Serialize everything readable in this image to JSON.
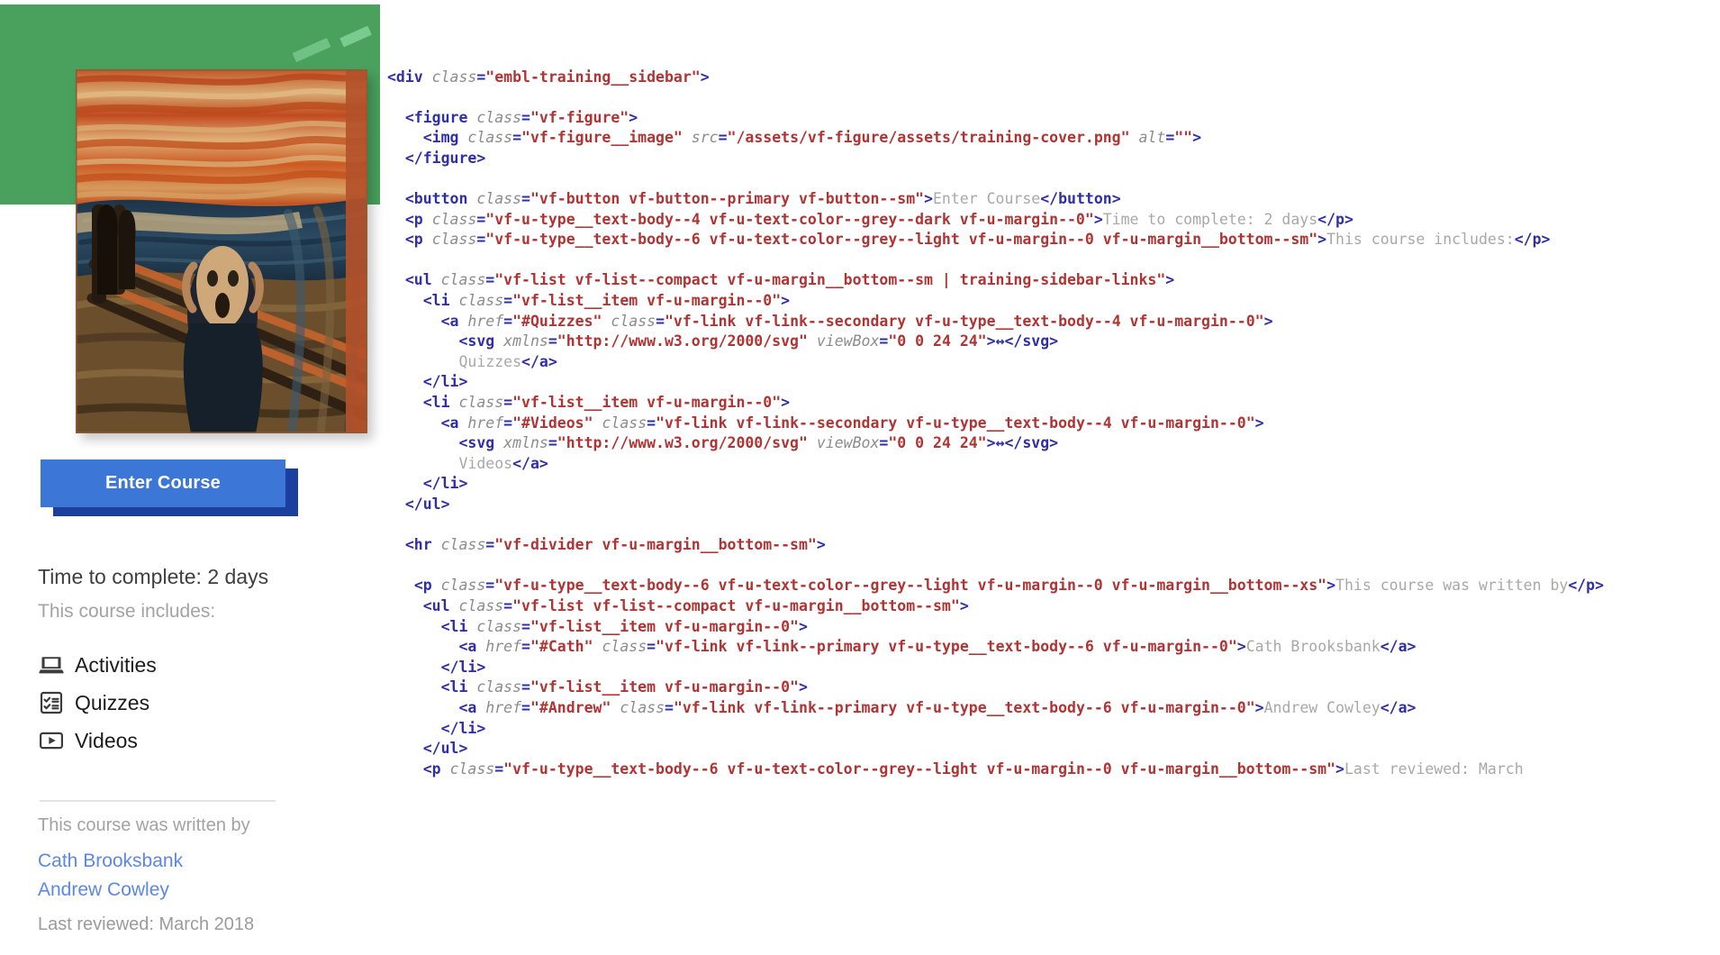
{
  "sidebar": {
    "cover": {
      "alt_label": "course-cover-image",
      "green_accent_color": "#4aa15e",
      "green_dash_color": "#6fc184"
    },
    "enter_course_label": "Enter Course",
    "enter_course_color": "#3c76d6",
    "enter_course_shadow_color": "#1b3f9f",
    "time_to_complete": "Time to complete: 2 days",
    "course_includes_label": "This course includes:",
    "includes": [
      {
        "icon": "laptop-icon",
        "label": "Activities"
      },
      {
        "icon": "checklist-icon",
        "label": "Quizzes"
      },
      {
        "icon": "video-play-icon",
        "label": "Videos"
      }
    ],
    "written_by_label": "This course was written by",
    "authors": [
      {
        "name": "Cath Brooksbank"
      },
      {
        "name": "Andrew Cowley"
      }
    ],
    "author_link_color": "#5b87e8",
    "last_reviewed": "Last reviewed: March 2018"
  },
  "code": {
    "language": "html",
    "colors": {
      "tag": "#2f2fa8",
      "attribute": "#8c8c8c",
      "value": "#b03434",
      "text": "#a8a8a8",
      "background": "#ffffff"
    },
    "lines": [
      [
        {
          "t": "tag",
          "s": "<div "
        },
        {
          "t": "attr",
          "s": "class"
        },
        {
          "t": "tag",
          "s": "="
        },
        {
          "t": "val",
          "s": "\"embl-training__sidebar\""
        },
        {
          "t": "tag",
          "s": ">"
        }
      ],
      [],
      [
        {
          "t": "tag",
          "s": "  <figure "
        },
        {
          "t": "attr",
          "s": "class"
        },
        {
          "t": "tag",
          "s": "="
        },
        {
          "t": "val",
          "s": "\"vf-figure\""
        },
        {
          "t": "tag",
          "s": ">"
        }
      ],
      [
        {
          "t": "tag",
          "s": "    <img "
        },
        {
          "t": "attr",
          "s": "class"
        },
        {
          "t": "tag",
          "s": "="
        },
        {
          "t": "val",
          "s": "\"vf-figure__image\""
        },
        {
          "t": "tag",
          "s": " "
        },
        {
          "t": "attr",
          "s": "src"
        },
        {
          "t": "tag",
          "s": "="
        },
        {
          "t": "val",
          "s": "\"/assets/vf-figure/assets/training-cover.png\""
        },
        {
          "t": "tag",
          "s": " "
        },
        {
          "t": "attr",
          "s": "alt"
        },
        {
          "t": "tag",
          "s": "="
        },
        {
          "t": "val",
          "s": "\"\""
        },
        {
          "t": "tag",
          "s": ">"
        }
      ],
      [
        {
          "t": "tag",
          "s": "  </figure>"
        }
      ],
      [],
      [
        {
          "t": "tag",
          "s": "  <button "
        },
        {
          "t": "attr",
          "s": "class"
        },
        {
          "t": "tag",
          "s": "="
        },
        {
          "t": "val",
          "s": "\"vf-button vf-button--primary vf-button--sm\""
        },
        {
          "t": "tag",
          "s": ">"
        },
        {
          "t": "txt",
          "s": "Enter Course"
        },
        {
          "t": "tag",
          "s": "</button>"
        }
      ],
      [
        {
          "t": "tag",
          "s": "  <p "
        },
        {
          "t": "attr",
          "s": "class"
        },
        {
          "t": "tag",
          "s": "="
        },
        {
          "t": "val",
          "s": "\"vf-u-type__text-body--4 vf-u-text-color--grey--dark vf-u-margin--0\""
        },
        {
          "t": "tag",
          "s": ">"
        },
        {
          "t": "txt",
          "s": "Time to complete: 2 days"
        },
        {
          "t": "tag",
          "s": "</p>"
        }
      ],
      [
        {
          "t": "tag",
          "s": "  <p "
        },
        {
          "t": "attr",
          "s": "class"
        },
        {
          "t": "tag",
          "s": "="
        },
        {
          "t": "val",
          "s": "\"vf-u-type__text-body--6 vf-u-text-color--grey--light vf-u-margin--0 vf-u-margin__bottom--sm\""
        },
        {
          "t": "tag",
          "s": ">"
        },
        {
          "t": "txt",
          "s": "This course includes:"
        },
        {
          "t": "tag",
          "s": "</p>"
        }
      ],
      [],
      [
        {
          "t": "tag",
          "s": "  <ul "
        },
        {
          "t": "attr",
          "s": "class"
        },
        {
          "t": "tag",
          "s": "="
        },
        {
          "t": "val",
          "s": "\"vf-list vf-list--compact vf-u-margin__bottom--sm | training-sidebar-links\""
        },
        {
          "t": "tag",
          "s": ">"
        }
      ],
      [
        {
          "t": "tag",
          "s": "    <li "
        },
        {
          "t": "attr",
          "s": "class"
        },
        {
          "t": "tag",
          "s": "="
        },
        {
          "t": "val",
          "s": "\"vf-list__item vf-u-margin--0\""
        },
        {
          "t": "tag",
          "s": ">"
        }
      ],
      [
        {
          "t": "tag",
          "s": "      <a "
        },
        {
          "t": "attr",
          "s": "href"
        },
        {
          "t": "tag",
          "s": "="
        },
        {
          "t": "val",
          "s": "\"#Quizzes\""
        },
        {
          "t": "tag",
          "s": " "
        },
        {
          "t": "attr",
          "s": "class"
        },
        {
          "t": "tag",
          "s": "="
        },
        {
          "t": "val",
          "s": "\"vf-link vf-link--secondary vf-u-type__text-body--4 vf-u-margin--0\""
        },
        {
          "t": "tag",
          "s": ">"
        }
      ],
      [
        {
          "t": "tag",
          "s": "        <svg "
        },
        {
          "t": "attr",
          "s": "xmlns"
        },
        {
          "t": "tag",
          "s": "="
        },
        {
          "t": "val",
          "s": "\"http://www.w3.org/2000/svg\""
        },
        {
          "t": "tag",
          "s": " "
        },
        {
          "t": "attr",
          "s": "viewBox"
        },
        {
          "t": "tag",
          "s": "="
        },
        {
          "t": "val",
          "s": "\"0 0 24 24\""
        },
        {
          "t": "tag",
          "s": ">"
        },
        {
          "t": "punc",
          "s": "↔"
        },
        {
          "t": "tag",
          "s": "</svg>"
        }
      ],
      [
        {
          "t": "txt",
          "s": "        Quizzes"
        },
        {
          "t": "tag",
          "s": "</a>"
        }
      ],
      [
        {
          "t": "tag",
          "s": "    </li>"
        }
      ],
      [
        {
          "t": "tag",
          "s": "    <li "
        },
        {
          "t": "attr",
          "s": "class"
        },
        {
          "t": "tag",
          "s": "="
        },
        {
          "t": "val",
          "s": "\"vf-list__item vf-u-margin--0\""
        },
        {
          "t": "tag",
          "s": ">"
        }
      ],
      [
        {
          "t": "tag",
          "s": "      <a "
        },
        {
          "t": "attr",
          "s": "href"
        },
        {
          "t": "tag",
          "s": "="
        },
        {
          "t": "val",
          "s": "\"#Videos\""
        },
        {
          "t": "tag",
          "s": " "
        },
        {
          "t": "attr",
          "s": "class"
        },
        {
          "t": "tag",
          "s": "="
        },
        {
          "t": "val",
          "s": "\"vf-link vf-link--secondary vf-u-type__text-body--4 vf-u-margin--0\""
        },
        {
          "t": "tag",
          "s": ">"
        }
      ],
      [
        {
          "t": "tag",
          "s": "        <svg "
        },
        {
          "t": "attr",
          "s": "xmlns"
        },
        {
          "t": "tag",
          "s": "="
        },
        {
          "t": "val",
          "s": "\"http://www.w3.org/2000/svg\""
        },
        {
          "t": "tag",
          "s": " "
        },
        {
          "t": "attr",
          "s": "viewBox"
        },
        {
          "t": "tag",
          "s": "="
        },
        {
          "t": "val",
          "s": "\"0 0 24 24\""
        },
        {
          "t": "tag",
          "s": ">"
        },
        {
          "t": "punc",
          "s": "↔"
        },
        {
          "t": "tag",
          "s": "</svg>"
        }
      ],
      [
        {
          "t": "txt",
          "s": "        Videos"
        },
        {
          "t": "tag",
          "s": "</a>"
        }
      ],
      [
        {
          "t": "tag",
          "s": "    </li>"
        }
      ],
      [
        {
          "t": "tag",
          "s": "  </ul>"
        }
      ],
      [],
      [
        {
          "t": "tag",
          "s": "  <hr "
        },
        {
          "t": "attr",
          "s": "class"
        },
        {
          "t": "tag",
          "s": "="
        },
        {
          "t": "val",
          "s": "\"vf-divider vf-u-margin__bottom--sm\""
        },
        {
          "t": "tag",
          "s": ">"
        }
      ],
      [],
      [
        {
          "t": "tag",
          "s": "   <p "
        },
        {
          "t": "attr",
          "s": "class"
        },
        {
          "t": "tag",
          "s": "="
        },
        {
          "t": "val",
          "s": "\"vf-u-type__text-body--6 vf-u-text-color--grey--light vf-u-margin--0 vf-u-margin__bottom--xs\""
        },
        {
          "t": "tag",
          "s": ">"
        },
        {
          "t": "txt",
          "s": "This course was written by"
        },
        {
          "t": "tag",
          "s": "</p>"
        }
      ],
      [
        {
          "t": "tag",
          "s": "    <ul "
        },
        {
          "t": "attr",
          "s": "class"
        },
        {
          "t": "tag",
          "s": "="
        },
        {
          "t": "val",
          "s": "\"vf-list vf-list--compact vf-u-margin__bottom--sm\""
        },
        {
          "t": "tag",
          "s": ">"
        }
      ],
      [
        {
          "t": "tag",
          "s": "      <li "
        },
        {
          "t": "attr",
          "s": "class"
        },
        {
          "t": "tag",
          "s": "="
        },
        {
          "t": "val",
          "s": "\"vf-list__item vf-u-margin--0\""
        },
        {
          "t": "tag",
          "s": ">"
        }
      ],
      [
        {
          "t": "tag",
          "s": "        <a "
        },
        {
          "t": "attr",
          "s": "href"
        },
        {
          "t": "tag",
          "s": "="
        },
        {
          "t": "val",
          "s": "\"#Cath\""
        },
        {
          "t": "tag",
          "s": " "
        },
        {
          "t": "attr",
          "s": "class"
        },
        {
          "t": "tag",
          "s": "="
        },
        {
          "t": "val",
          "s": "\"vf-link vf-link--primary vf-u-type__text-body--6 vf-u-margin--0\""
        },
        {
          "t": "tag",
          "s": ">"
        },
        {
          "t": "txt",
          "s": "Cath Brooksbank"
        },
        {
          "t": "tag",
          "s": "</a>"
        }
      ],
      [
        {
          "t": "tag",
          "s": "      </li>"
        }
      ],
      [
        {
          "t": "tag",
          "s": "      <li "
        },
        {
          "t": "attr",
          "s": "class"
        },
        {
          "t": "tag",
          "s": "="
        },
        {
          "t": "val",
          "s": "\"vf-list__item vf-u-margin--0\""
        },
        {
          "t": "tag",
          "s": ">"
        }
      ],
      [
        {
          "t": "tag",
          "s": "        <a "
        },
        {
          "t": "attr",
          "s": "href"
        },
        {
          "t": "tag",
          "s": "="
        },
        {
          "t": "val",
          "s": "\"#Andrew\""
        },
        {
          "t": "tag",
          "s": " "
        },
        {
          "t": "attr",
          "s": "class"
        },
        {
          "t": "tag",
          "s": "="
        },
        {
          "t": "val",
          "s": "\"vf-link vf-link--primary vf-u-type__text-body--6 vf-u-margin--0\""
        },
        {
          "t": "tag",
          "s": ">"
        },
        {
          "t": "txt",
          "s": "Andrew Cowley"
        },
        {
          "t": "tag",
          "s": "</a>"
        }
      ],
      [
        {
          "t": "tag",
          "s": "      </li>"
        }
      ],
      [
        {
          "t": "tag",
          "s": "    </ul>"
        }
      ],
      [
        {
          "t": "tag",
          "s": "    <p "
        },
        {
          "t": "attr",
          "s": "class"
        },
        {
          "t": "tag",
          "s": "="
        },
        {
          "t": "val",
          "s": "\"vf-u-type__text-body--6 vf-u-text-color--grey--light vf-u-margin--0 vf-u-margin__bottom--sm\""
        },
        {
          "t": "tag",
          "s": ">"
        },
        {
          "t": "txt",
          "s": "Last reviewed: March"
        }
      ]
    ]
  }
}
